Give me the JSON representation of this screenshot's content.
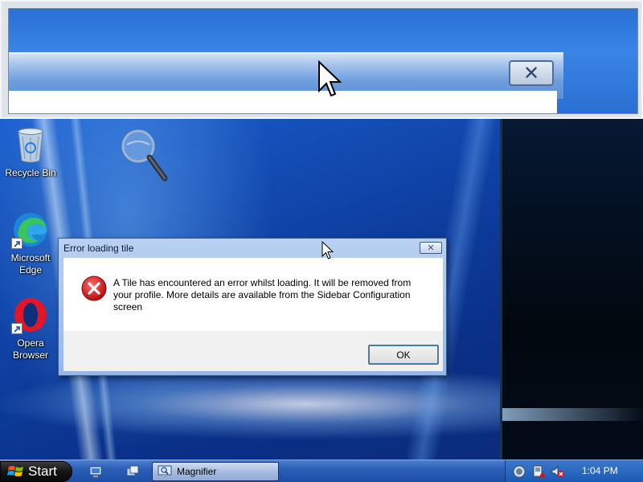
{
  "desktop": {
    "icons": [
      {
        "label": "Recycle Bin"
      },
      {
        "label": "Microsoft Edge"
      },
      {
        "label": "Opera Browser"
      }
    ]
  },
  "magnifier_pane": {
    "close_glyph": "✕"
  },
  "dialog": {
    "title": "Error loading tile",
    "message": "A Tile has encountered an error whilst loading. It will be removed from your profile. More details are available from the Sidebar Configuration screen",
    "ok_label": "OK",
    "close_glyph": "✕",
    "icon": "error-icon"
  },
  "taskbar": {
    "start_label": "Start",
    "task_button_label": "Magnifier",
    "clock": "1:04 PM",
    "quick_launch": [
      "show-desktop-icon",
      "switch-windows-icon"
    ],
    "tray_icons": [
      "network-icon",
      "device-icon",
      "volume-muted-icon"
    ]
  },
  "colors": {
    "taskbar": "#2a5fb8",
    "dialog_frame": "#93b8e8",
    "error_red": "#d01818"
  }
}
